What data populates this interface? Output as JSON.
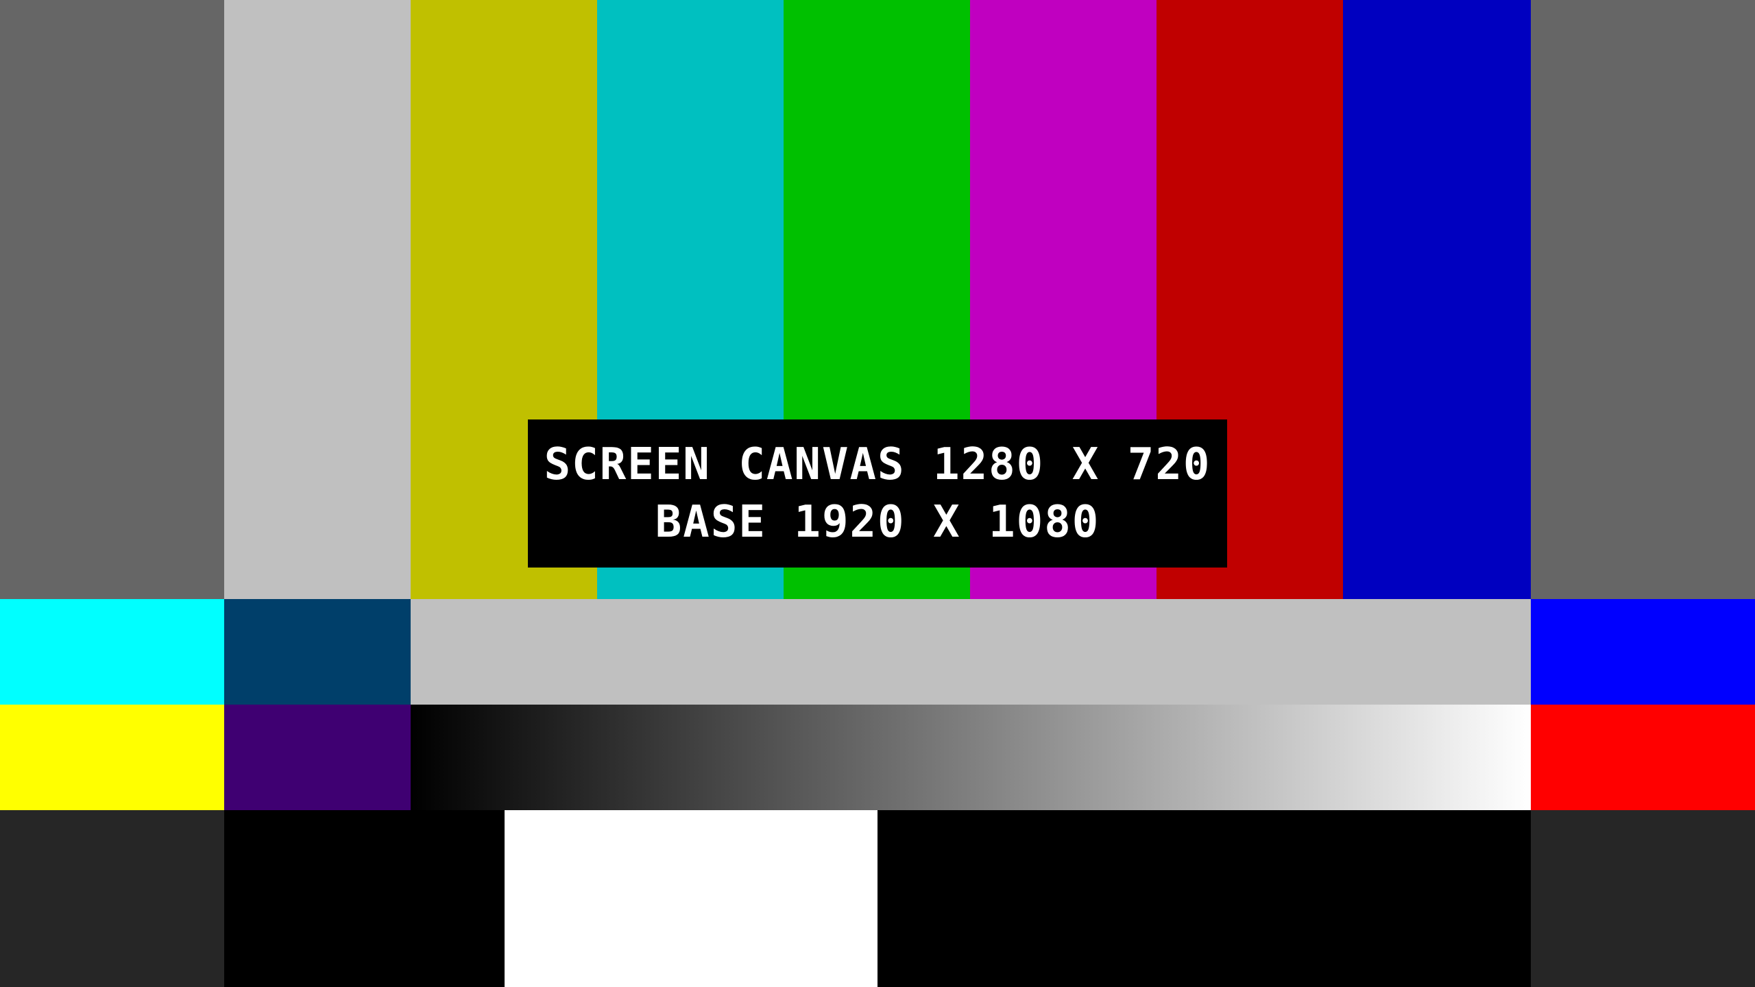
{
  "overlay": {
    "line1": "SCREEN CANVAS 1280 X 720",
    "line2": "BASE 1920 X 1080"
  },
  "colors": {
    "top_bars": [
      "#666666",
      "#c0c0c0",
      "#c0c000",
      "#00c0c0",
      "#00c000",
      "#c000c0",
      "#c00000",
      "#0000c0",
      "#666666"
    ],
    "mid1": [
      "#00ffff",
      "#003f6a",
      "#c0c0c0",
      "#0000ff"
    ],
    "mid2_left": [
      "#ffff00",
      "#3f0072"
    ],
    "mid2_gradient": [
      "#000000",
      "#ffffff"
    ],
    "mid2_right": "#ff0000",
    "bottom": [
      "#262626",
      "#000000",
      "#ffffff",
      "#000000",
      "#262626"
    ]
  }
}
